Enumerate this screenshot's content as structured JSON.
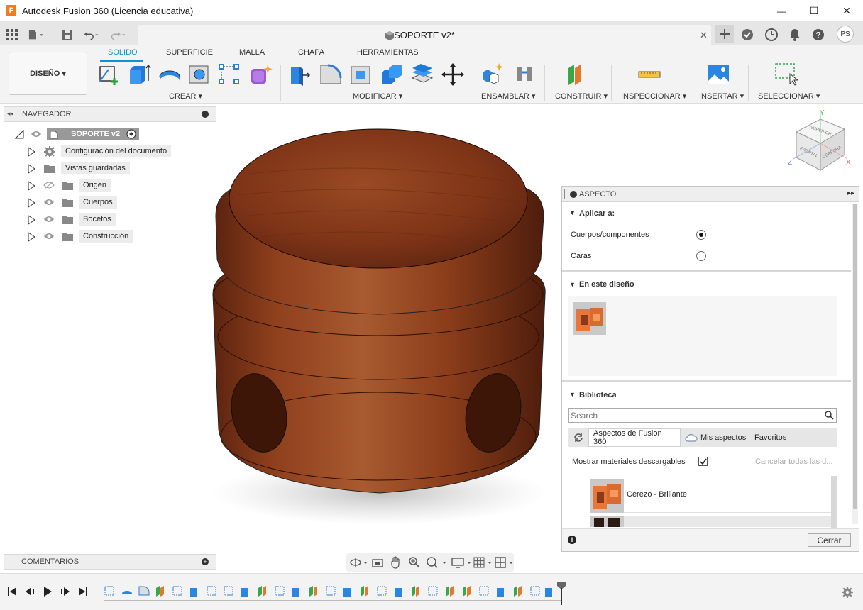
{
  "window": {
    "title": "Autodesk Fusion 360 (Licencia educativa)",
    "logo_letter": "F",
    "minimize": "—",
    "maximize": "☐",
    "close": "✕"
  },
  "document_tab": {
    "title": "SOPORTE v2*",
    "close": "✕"
  },
  "user": {
    "initials": "PS"
  },
  "workspace": {
    "label": "DISEÑO ▾"
  },
  "ribbon": {
    "tabs": [
      "SOLIDO",
      "SUPERFICIE",
      "MALLA",
      "CHAPA",
      "HERRAMIENTAS"
    ],
    "groups": [
      "CREAR ▾",
      "MODIFICAR ▾",
      "ENSAMBLAR ▾",
      "CONSTRUIR ▾",
      "INSPECCIONAR ▾",
      "INSERTAR ▾",
      "SELECCIONAR ▾"
    ]
  },
  "navigator": {
    "title": "NAVEGADOR",
    "root": "SOPORTE v2",
    "items": [
      "Configuración del documento",
      "Vistas guardadas",
      "Origen",
      "Cuerpos",
      "Bocetos",
      "Construcción"
    ]
  },
  "comments": {
    "title": "COMENTARIOS"
  },
  "viewcube": {
    "top": "SUPERIOR",
    "front": "FRONTAL",
    "right": "DERECHA",
    "x": "X",
    "y": "Y",
    "z": "Z"
  },
  "aspect_panel": {
    "title": "ASPECTO",
    "apply_title": "Aplicar a:",
    "apply_options": [
      {
        "label": "Cuerpos/componentes",
        "selected": true
      },
      {
        "label": "Caras",
        "selected": false
      }
    ],
    "in_design_title": "En este diseño",
    "library_title": "Biblioteca",
    "search_placeholder": "Search",
    "library_tabs": [
      "Aspectos de Fusion 360",
      "Mis aspectos",
      "Favoritos"
    ],
    "show_downloadable": "Mostrar materiales descargables",
    "cancel_all": "Cancelar todas las d...",
    "materials": [
      "Cerezo - Brillante"
    ],
    "close_label": "Cerrar",
    "info": "i"
  },
  "colors": {
    "accent": "#0696d7",
    "wood": "#8b3f1e",
    "logo": "#f47a20"
  }
}
